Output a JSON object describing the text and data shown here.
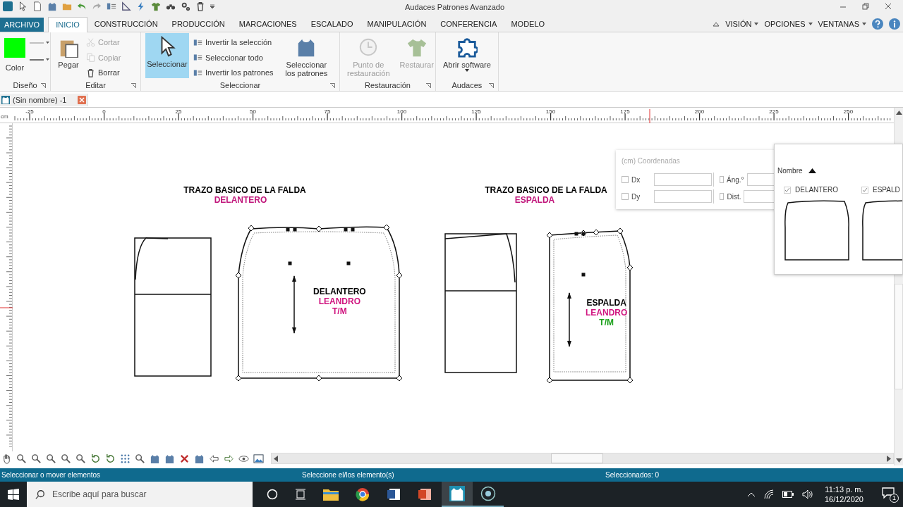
{
  "window": {
    "title": "Audaces Patrones Avanzado"
  },
  "file_button": "ARCHIVO",
  "menu_tabs": [
    {
      "label": "INICIO",
      "kind": "tab",
      "selected": true
    },
    {
      "label": "CONSTRUCCIÓN",
      "kind": "tab",
      "selected": false
    },
    {
      "label": "PRODUCCIÓN",
      "kind": "tab",
      "selected": false
    },
    {
      "label": "MARCACIONES",
      "kind": "tab",
      "selected": false
    },
    {
      "label": "ESCALADO",
      "kind": "tab",
      "selected": false
    },
    {
      "label": "MANIPULACIÓN",
      "kind": "tab",
      "selected": false
    },
    {
      "label": "CONFERENCIA",
      "kind": "tab",
      "selected": false
    },
    {
      "label": "MODELO",
      "kind": "tab",
      "selected": false
    }
  ],
  "menu_right": [
    "VISIÓN",
    "OPCIONES",
    "VENTANAS"
  ],
  "ribbon_groups": [
    {
      "title": "Diseño",
      "items": [
        {
          "kind": "color",
          "label": "Color",
          "color": "#00ff00"
        }
      ]
    },
    {
      "title": "Editar",
      "items": [
        {
          "kind": "large",
          "label": "Pegar",
          "disabled": false,
          "selected": false
        },
        {
          "kind": "small",
          "label": "Cortar",
          "disabled": true
        },
        {
          "kind": "small",
          "label": "Copiar",
          "disabled": true
        },
        {
          "kind": "small",
          "label": "Borrar",
          "disabled": false
        }
      ]
    },
    {
      "title": "Seleccionar",
      "items": [
        {
          "kind": "large",
          "label": "Seleccionar",
          "disabled": false,
          "selected": true
        },
        {
          "kind": "small",
          "label": "Invertir la selección",
          "disabled": false
        },
        {
          "kind": "small",
          "label": "Seleccionar todo",
          "disabled": false
        },
        {
          "kind": "small",
          "label": "Invertir los patrones",
          "disabled": false
        },
        {
          "kind": "large",
          "label": "Seleccionar los patrones",
          "disabled": false,
          "selected": false
        }
      ]
    },
    {
      "title": "Restauración",
      "items": [
        {
          "kind": "large",
          "label": "Punto de restauración",
          "disabled": true,
          "selected": false
        },
        {
          "kind": "large",
          "label": "Restaurar",
          "disabled": true,
          "selected": false
        }
      ]
    },
    {
      "title": "Audaces",
      "items": [
        {
          "kind": "large",
          "label": "Abrir software",
          "disabled": false,
          "selected": false,
          "dropdown": true
        }
      ]
    }
  ],
  "document_tab": {
    "title": "(Sin nombre) -1"
  },
  "ruler": {
    "unit": "cm",
    "labels": [
      "-25",
      "0",
      "25",
      "50",
      "75",
      "100",
      "125",
      "150",
      "175",
      "200",
      "225",
      "250"
    ]
  },
  "canvas": {
    "drafts": [
      {
        "title": "TRAZO BASICO DE LA FALDA",
        "subtitle": "DELANTERO"
      },
      {
        "title": "TRAZO BASICO DE LA FALDA",
        "subtitle": "ESPALDA"
      }
    ],
    "pieces": [
      {
        "lines": [
          {
            "text": "DELANTERO",
            "color": "#000000"
          },
          {
            "text": "LEANDRO",
            "color": "#d0147f"
          },
          {
            "text": "T/M",
            "color": "#d0147f"
          }
        ]
      },
      {
        "lines": [
          {
            "text": "ESPALDA",
            "color": "#000000"
          },
          {
            "text": "LEANDRO",
            "color": "#d0147f"
          },
          {
            "text": "T/M",
            "color": "#1aa01a"
          }
        ]
      }
    ]
  },
  "coordinates_panel": {
    "title": "(cm) Coordenadas",
    "fields": [
      {
        "label": "Dx",
        "checked": false
      },
      {
        "label": "Dy",
        "checked": false
      },
      {
        "label": "Áng.°",
        "checked": false
      },
      {
        "label": "Dist.",
        "checked": false
      }
    ]
  },
  "pieces_panel": {
    "header": "Nombre",
    "items": [
      {
        "name": "DELANTERO",
        "checked": true
      },
      {
        "name": "ESPALD",
        "checked": true
      }
    ]
  },
  "status_bar": {
    "left": "Seleccionar o mover elementos",
    "center": "Seleccione el/los elemento(s)",
    "right": "Seleccionados: 0"
  },
  "taskbar": {
    "search_placeholder": "Escribe aquí para buscar",
    "time": "11:13 p. m.",
    "date": "16/12/2020",
    "notifications": "1"
  }
}
